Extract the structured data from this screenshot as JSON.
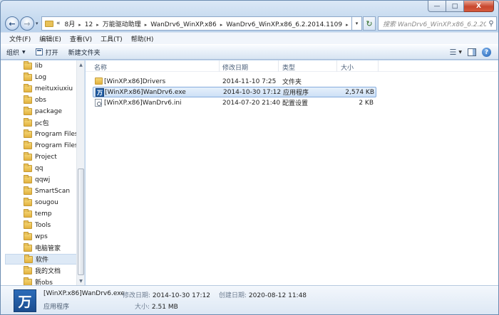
{
  "window": {
    "controls": {
      "minimize": "—",
      "maximize": "□",
      "close": "X"
    }
  },
  "nav": {
    "back_glyph": "←",
    "forward_glyph": "→",
    "dropdown_glyph": "▾",
    "refresh_glyph": "↻"
  },
  "address": {
    "overflow": "«",
    "crumbs": [
      "8月",
      "12",
      "万能驱动助理",
      "WanDrv6_WinXP.x86",
      "WanDrv6_WinXP.x86_6.2.2014.1109"
    ],
    "separator": "▸",
    "dropdown_glyph": "▾"
  },
  "search": {
    "placeholder": "搜索 WanDrv6_WinXP.x86_6.2.2014...",
    "icon_glyph": "⚲"
  },
  "menu": {
    "items": [
      "文件(F)",
      "编辑(E)",
      "查看(V)",
      "工具(T)",
      "帮助(H)"
    ]
  },
  "commands": {
    "organize": "组织",
    "organize_caret": "▼",
    "open": "打开",
    "new_folder": "新建文件夹",
    "view_glyph": "☰",
    "view_caret": "▼",
    "help_glyph": "?"
  },
  "tree": {
    "items": [
      "lib",
      "Log",
      "meituxiuxiu",
      "obs",
      "package",
      "pc包",
      "Program Files",
      "Program Files",
      "Project",
      "qq",
      "qqwj",
      "SmartScan",
      "sougou",
      "temp",
      "Tools",
      "wps",
      "电脑管家",
      "软件",
      "我的文档",
      "新obs"
    ],
    "selected_index": 17,
    "scroll_up": "▲",
    "scroll_down": "▼"
  },
  "columns": {
    "name": "名称",
    "modified": "修改日期",
    "type": "类型",
    "size": "大小"
  },
  "files": [
    {
      "icon": "folder-icon",
      "name": "[WinXP.x86]Drivers",
      "modified": "2014-11-10 7:25",
      "type": "文件夹",
      "size": ""
    },
    {
      "icon": "exe-icon",
      "icon_glyph": "万",
      "name": "[WinXP.x86]WanDrv6.exe",
      "modified": "2014-10-30 17:12",
      "type": "应用程序",
      "size": "2,574 KB"
    },
    {
      "icon": "ini-icon",
      "name": "[WinXP.x86]WanDrv6.ini",
      "modified": "2014-07-20 21:40",
      "type": "配置设置",
      "size": "2 KB"
    }
  ],
  "selected_file_index": 1,
  "details": {
    "icon_glyph": "万",
    "name": "[WinXP.x86]WanDrv6.exe",
    "type": "应用程序",
    "modified_label": "修改日期:",
    "modified_value": "2014-10-30 17:12",
    "created_label": "创建日期:",
    "created_value": "2020-08-12 11:48",
    "size_label": "大小:",
    "size_value": "2.51 MB"
  },
  "colors": {
    "accent": "#2360a8",
    "selection": "#cde0f6",
    "folder": "#e3b23f"
  }
}
